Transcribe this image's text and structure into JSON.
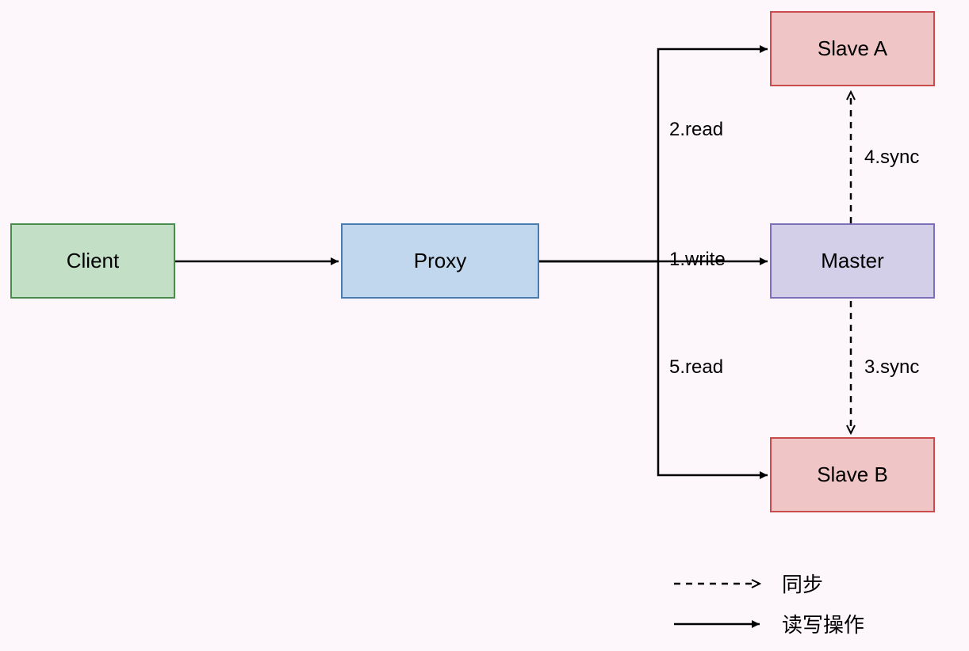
{
  "nodes": {
    "client": "Client",
    "proxy": "Proxy",
    "master": "Master",
    "slaveA": "Slave A",
    "slaveB": "Slave B"
  },
  "edges": {
    "write": "1.write",
    "readA": "2.read",
    "syncB": "3.sync",
    "syncA": "4.sync",
    "readB": "5.read"
  },
  "legend": {
    "sync": "同步",
    "rw": "读写操作"
  }
}
